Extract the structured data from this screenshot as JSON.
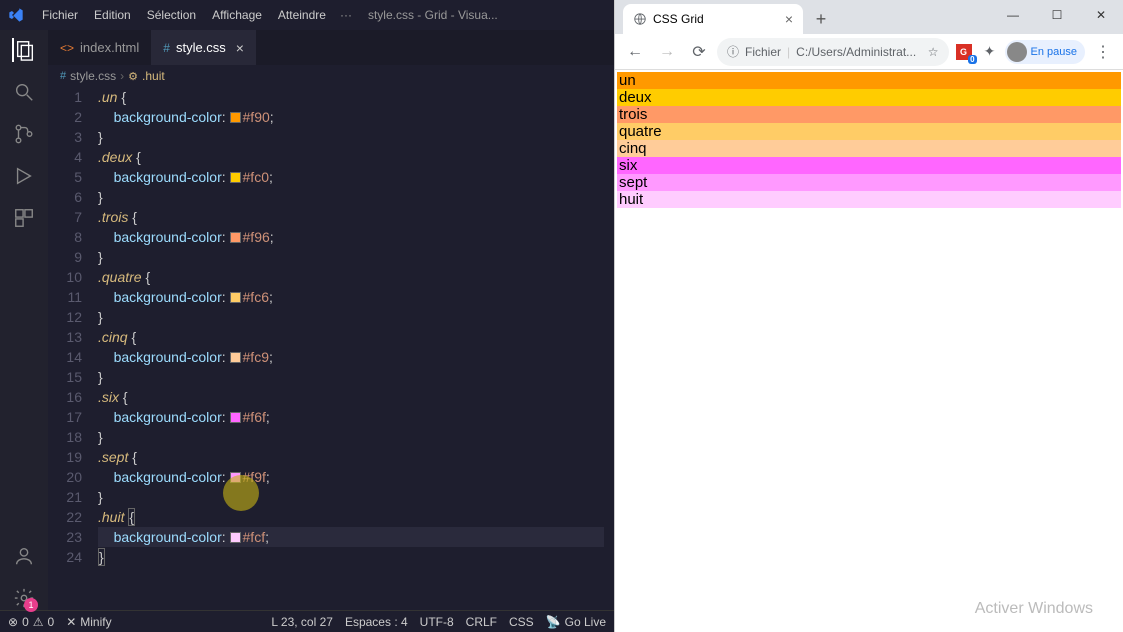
{
  "vscode": {
    "menus": [
      "Fichier",
      "Edition",
      "Sélection",
      "Affichage",
      "Atteindre"
    ],
    "title_suffix": "style.css - Grid - Visua...",
    "tabs": [
      {
        "label": "index.html",
        "active": false,
        "icon": "html"
      },
      {
        "label": "style.css",
        "active": true,
        "icon": "css"
      }
    ],
    "breadcrumb": {
      "file": "style.css",
      "selector": ".huit"
    },
    "status": {
      "errors": "0",
      "warnings": "0",
      "minify": "Minify",
      "cursor": "L 23, col 27",
      "spaces": "Espaces : 4",
      "encoding": "UTF-8",
      "eol": "CRLF",
      "lang": "CSS",
      "golive": "Go Live"
    },
    "code_lines": [
      {
        "n": 1,
        "sel": ".un",
        "open": true
      },
      {
        "n": 2,
        "prop": "background-color",
        "color": "#f90"
      },
      {
        "n": 3,
        "close": true
      },
      {
        "n": 4,
        "sel": ".deux",
        "open": true
      },
      {
        "n": 5,
        "prop": "background-color",
        "color": "#fc0"
      },
      {
        "n": 6,
        "close": true
      },
      {
        "n": 7,
        "sel": ".trois",
        "open": true
      },
      {
        "n": 8,
        "prop": "background-color",
        "color": "#f96"
      },
      {
        "n": 9,
        "close": true
      },
      {
        "n": 10,
        "sel": ".quatre",
        "open": true
      },
      {
        "n": 11,
        "prop": "background-color",
        "color": "#fc6"
      },
      {
        "n": 12,
        "close": true
      },
      {
        "n": 13,
        "sel": ".cinq",
        "open": true
      },
      {
        "n": 14,
        "prop": "background-color",
        "color": "#fc9"
      },
      {
        "n": 15,
        "close": true
      },
      {
        "n": 16,
        "sel": ".six",
        "open": true
      },
      {
        "n": 17,
        "prop": "background-color",
        "color": "#f6f"
      },
      {
        "n": 18,
        "close": true
      },
      {
        "n": 19,
        "sel": ".sept",
        "open": true
      },
      {
        "n": 20,
        "prop": "background-color",
        "color": "#f9f"
      },
      {
        "n": 21,
        "close": true
      },
      {
        "n": 22,
        "sel": ".huit",
        "open": true,
        "current": false,
        "bracket_match": true
      },
      {
        "n": 23,
        "prop": "background-color",
        "color": "#fcf",
        "current": true
      },
      {
        "n": 24,
        "close": true,
        "bracket_match": true
      }
    ]
  },
  "chrome": {
    "tab_title": "CSS Grid",
    "address_prefix": "Fichier",
    "address": "C:/Users/Administrat...",
    "profile_label": "En pause",
    "rows": [
      {
        "label": "un",
        "cls": "r-un"
      },
      {
        "label": "deux",
        "cls": "r-deux"
      },
      {
        "label": "trois",
        "cls": "r-trois"
      },
      {
        "label": "quatre",
        "cls": "r-quatre"
      },
      {
        "label": "cinq",
        "cls": "r-cinq"
      },
      {
        "label": "six",
        "cls": "r-six"
      },
      {
        "label": "sept",
        "cls": "r-sept"
      },
      {
        "label": "huit",
        "cls": "r-huit"
      }
    ],
    "watermark": "Activer Windows"
  }
}
